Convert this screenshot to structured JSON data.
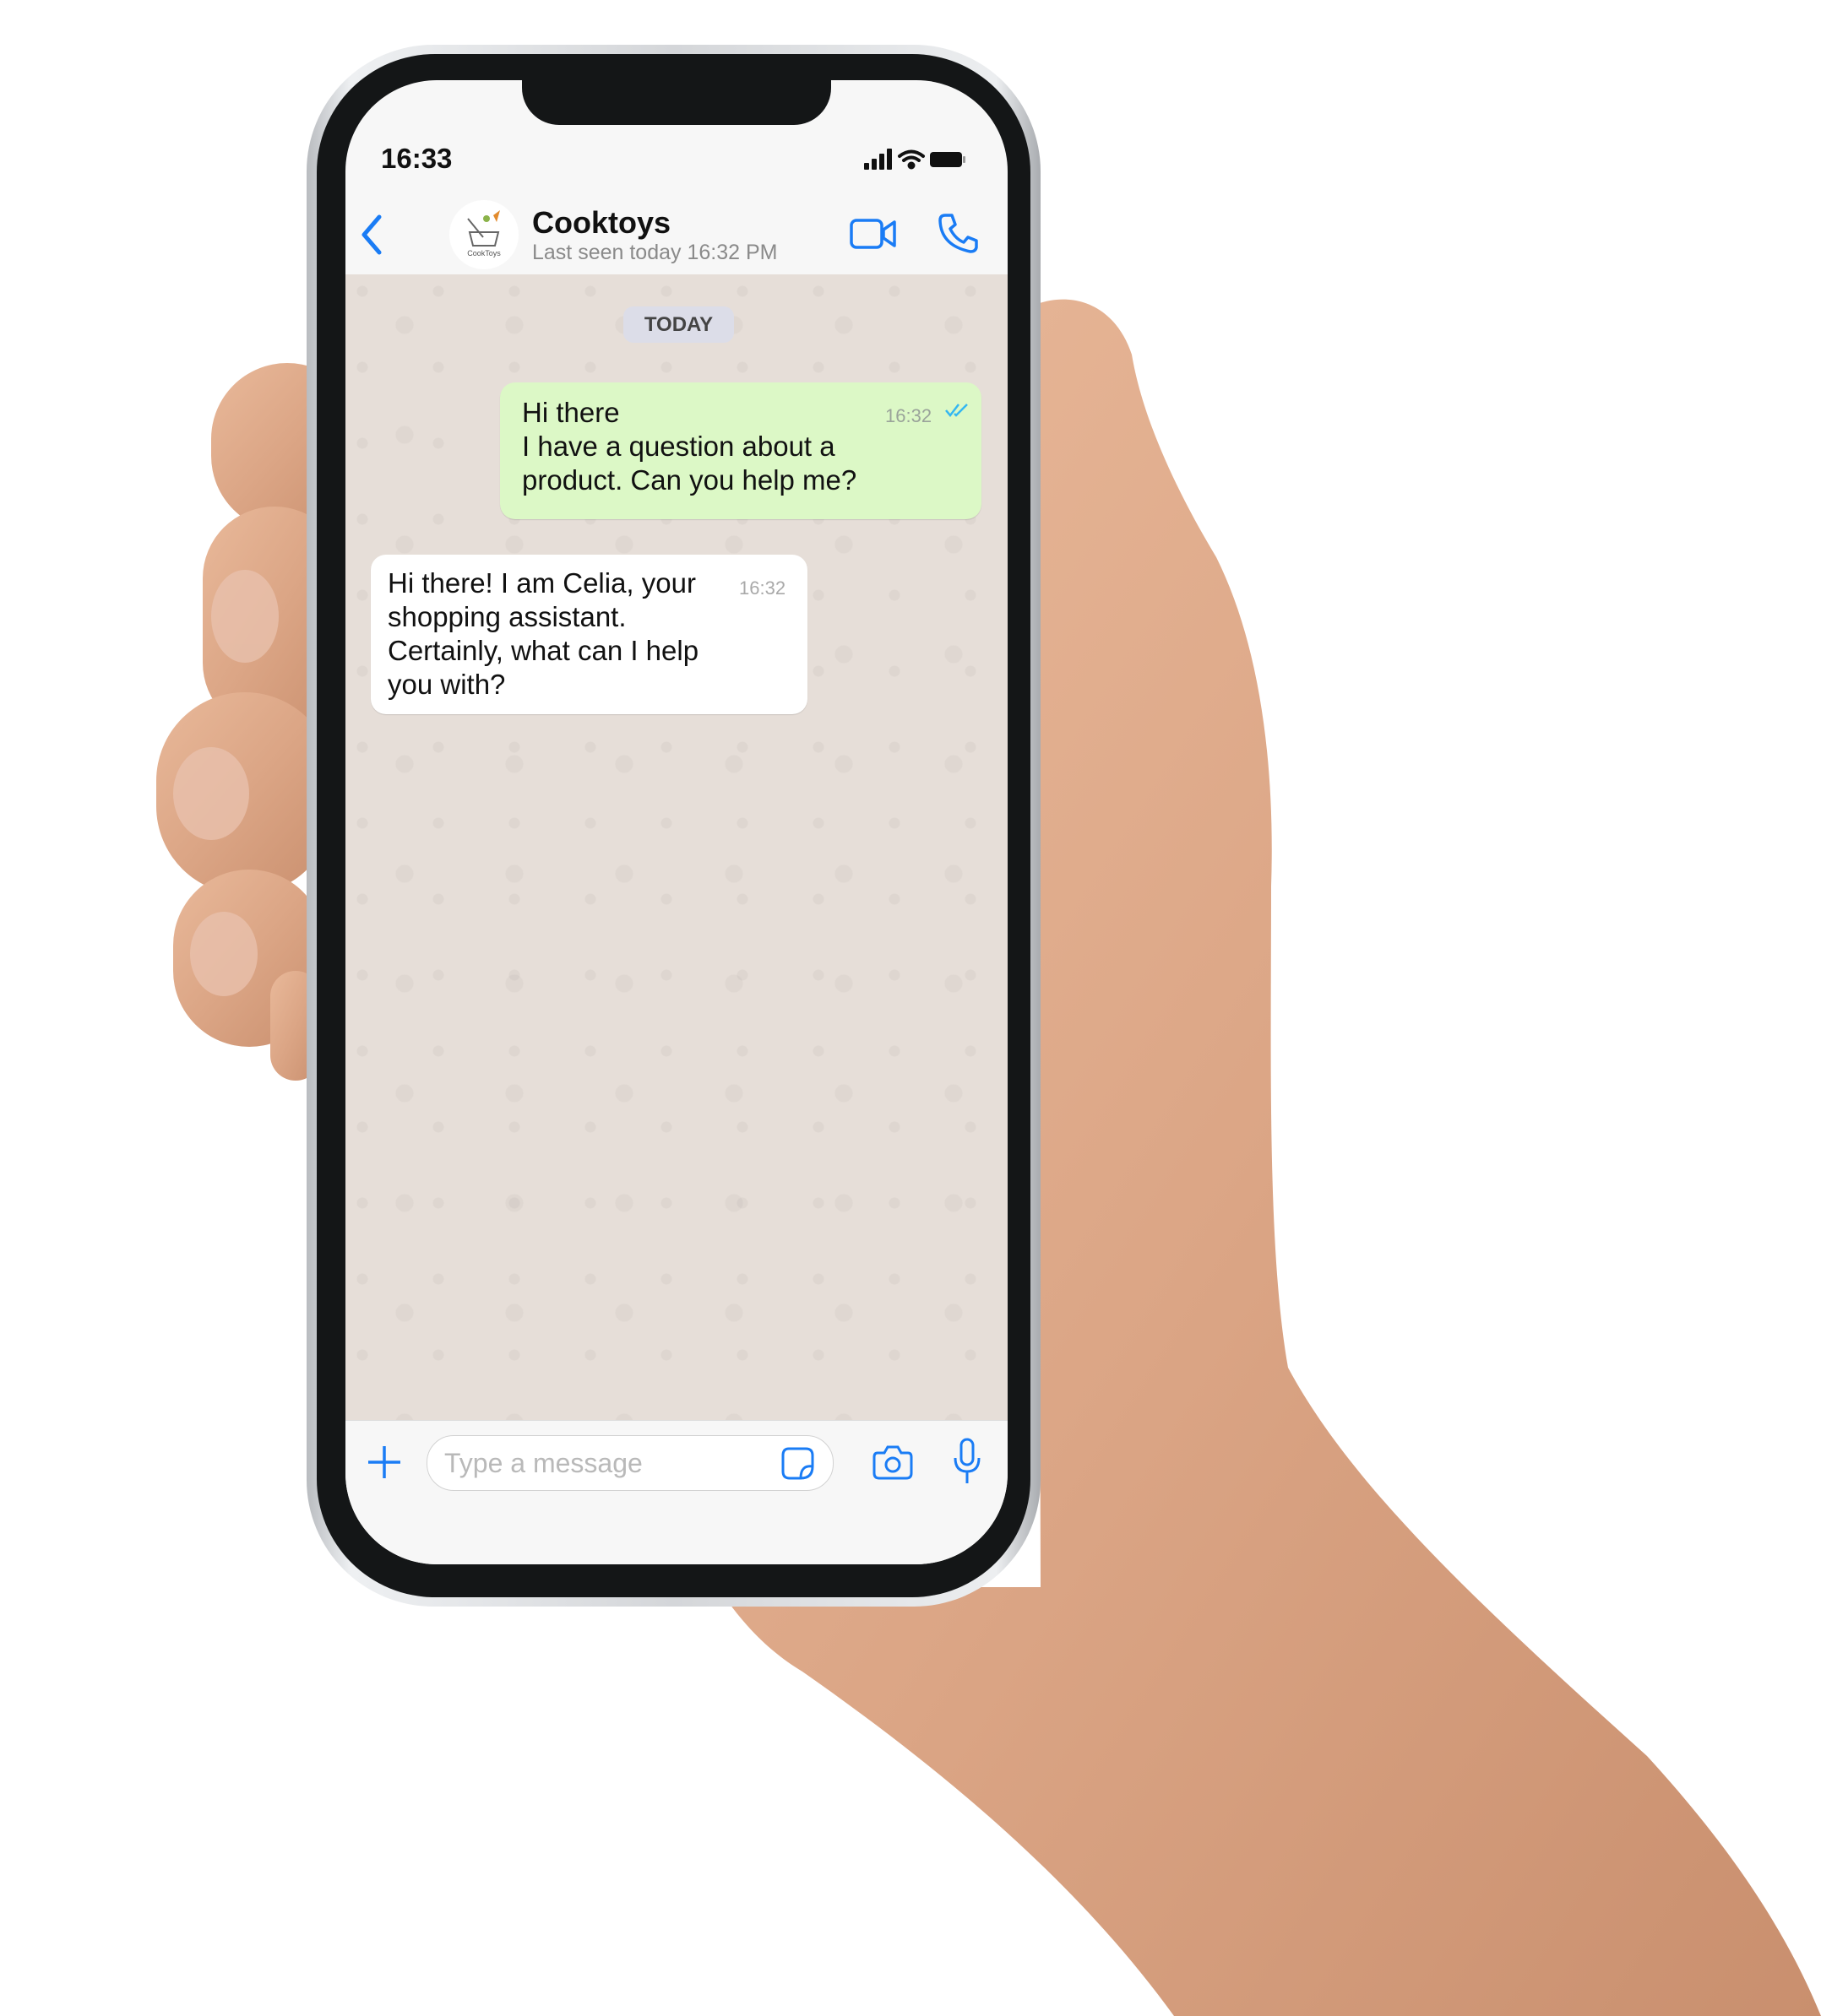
{
  "status_bar": {
    "time": "16:33"
  },
  "header": {
    "contact_name": "Cooktoys",
    "last_seen": "Last seen today 16:32 PM",
    "avatar_logo_text": "CookToys"
  },
  "chat": {
    "date_separator": "TODAY",
    "messages": [
      {
        "direction": "outgoing",
        "text": "Hi there\nI have a question about a\nproduct. Can you help me?",
        "time": "16:32",
        "status": "read"
      },
      {
        "direction": "incoming",
        "text": "Hi there! I am Celia, your\nshopping assistant.\nCertainly, what can I help\nyou with?",
        "time": "16:32"
      }
    ]
  },
  "input": {
    "placeholder": "Type a message"
  },
  "colors": {
    "accent": "#1a7cf5",
    "outgoing_bubble": "#dcf8c6",
    "incoming_bubble": "#ffffff",
    "chat_background": "#e6ded8",
    "read_ticks": "#34b7f1"
  }
}
